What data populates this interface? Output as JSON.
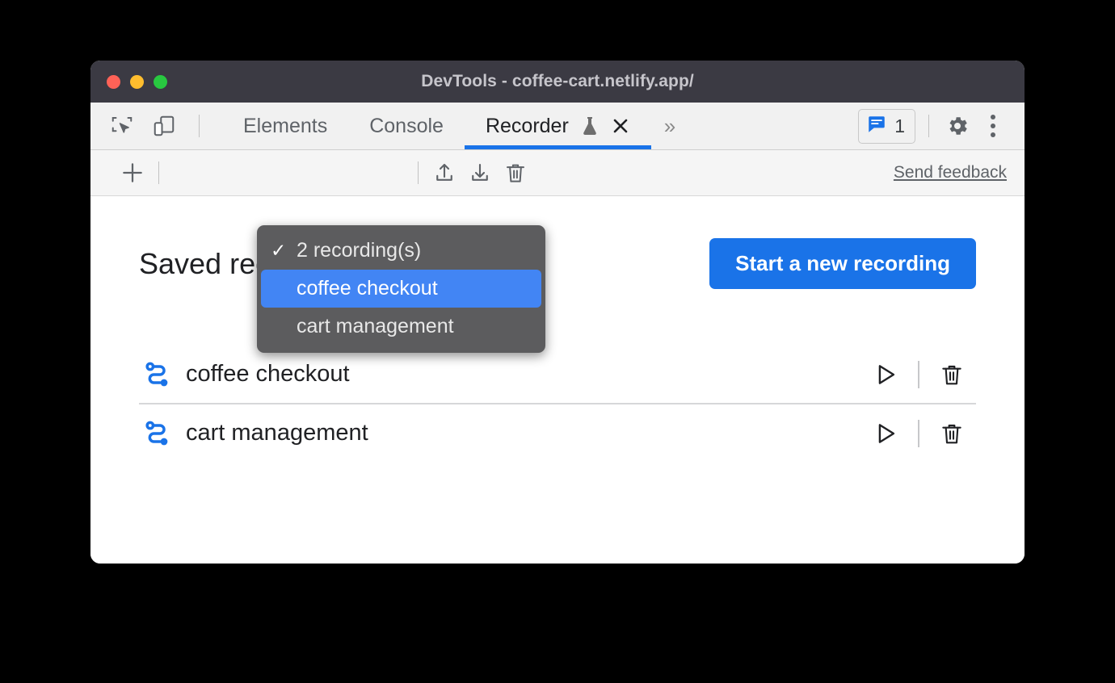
{
  "window": {
    "title": "DevTools - coffee-cart.netlify.app/",
    "traffic_lights": [
      {
        "name": "close",
        "color": "#ff6257"
      },
      {
        "name": "minimize",
        "color": "#ffbd2e"
      },
      {
        "name": "zoom",
        "color": "#28c840"
      }
    ]
  },
  "tab_strip": {
    "inspect_icon": "inspect-element-icon",
    "device_icon": "device-toolbar-icon",
    "tabs": [
      {
        "label": "Elements",
        "active": false
      },
      {
        "label": "Console",
        "active": false
      },
      {
        "label": "Recorder",
        "active": true,
        "experimental_icon": "beaker-icon",
        "closeable": true
      }
    ],
    "more_tabs_label": "»",
    "issues": {
      "icon": "issues-message-icon",
      "count": "1",
      "color": "#1a73e8"
    },
    "settings_icon": "gear-icon",
    "menu_icon": "three-dot-menu-icon"
  },
  "recorder_toolbar": {
    "add_label": "+",
    "export_icon": "export-icon",
    "import_icon": "import-icon",
    "delete_icon": "trash-icon",
    "feedback_label": "Send feedback"
  },
  "dropdown": {
    "header": {
      "label": "2 recording(s)",
      "checked": true,
      "check_glyph": "✓"
    },
    "items": [
      {
        "label": "coffee checkout",
        "selected": true
      },
      {
        "label": "cart management",
        "selected": false
      }
    ],
    "background": "#5c5c5e",
    "highlight": "#4285f4"
  },
  "main": {
    "title": "Saved recordings",
    "start_button": "Start a new recording",
    "start_button_color": "#1a73e8",
    "recordings": [
      {
        "name": "coffee checkout",
        "flow_icon": "user-flow-icon",
        "play_icon": "play-icon",
        "delete_icon": "trash-icon"
      },
      {
        "name": "cart management",
        "flow_icon": "user-flow-icon",
        "play_icon": "play-icon",
        "delete_icon": "trash-icon"
      }
    ]
  }
}
